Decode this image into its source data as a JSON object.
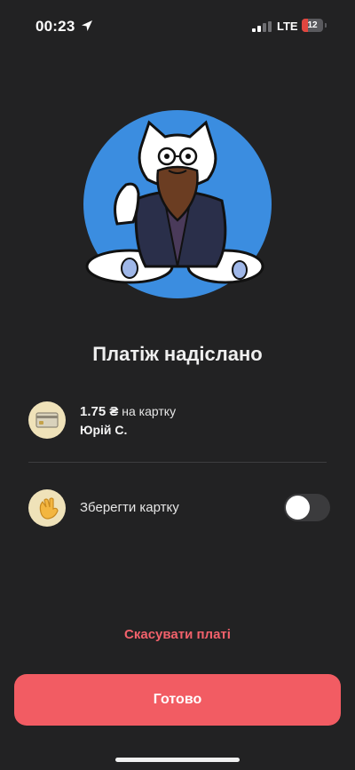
{
  "status_bar": {
    "time": "00:23",
    "network": "LTE",
    "battery_level": "12",
    "icons": [
      "location-arrow-icon",
      "cellular-signal-icon",
      "battery-icon"
    ]
  },
  "hero": {
    "icon": "cat-professor-illustration",
    "accent": "#3b8de0"
  },
  "title": "Платіж надіслано",
  "payment": {
    "icon": "bank-card-icon",
    "amount": "1.75 ₴",
    "destination": " на картку",
    "recipient": "Юрій С."
  },
  "save_card": {
    "icon": "waving-hand-icon",
    "label": "Зберегти картку",
    "toggle_on": false
  },
  "actions": {
    "cancel_label": "Скасувати платі",
    "done_label": "Готово"
  },
  "colors": {
    "background": "#222223",
    "accent": "#f25c63",
    "avatar_bg": "#3b8de0"
  }
}
